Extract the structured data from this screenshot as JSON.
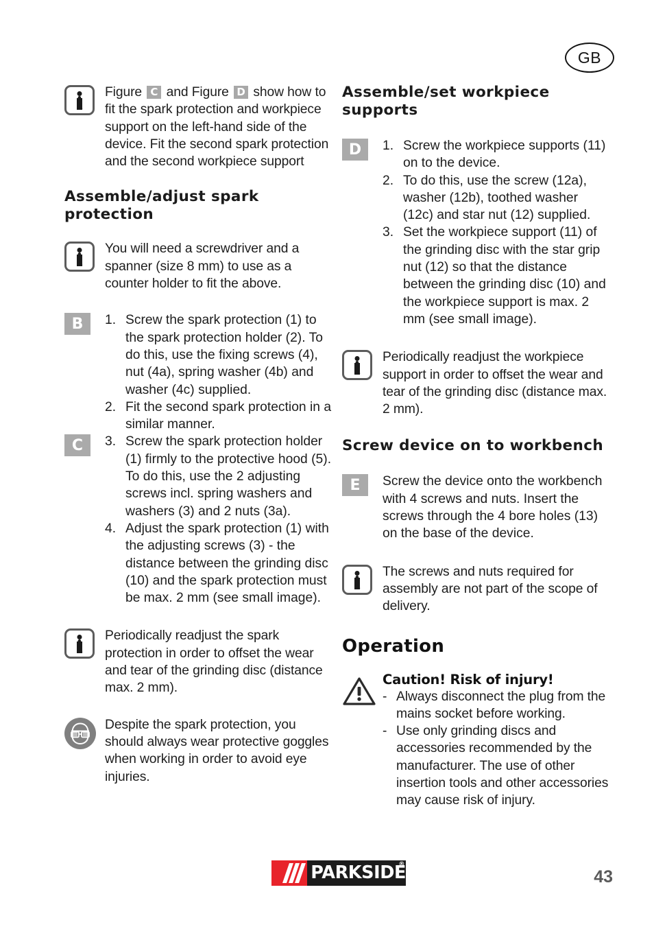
{
  "page": {
    "country_code": "GB",
    "number": "43",
    "brand": "PARKSIDE",
    "brand_registered": "®"
  },
  "left_column": {
    "note_figures": {
      "icon": "info-icon",
      "text_before": "Figure",
      "badge_c": "C",
      "text_middle": "and Figure",
      "badge_d": "D",
      "text_after": "show how to fit the spark protection and workpiece support on the left-hand side of the device. Fit the second spark protection and the second workpiece support"
    },
    "heading_spark": "Assemble/adjust spark protection",
    "note_tools": {
      "icon": "info-icon",
      "text": "You will need a screwdriver and a spanner (size 8 mm) to use as a counter holder to fit the above."
    },
    "steps_b": {
      "badge": "B",
      "items": [
        {
          "num": "1.",
          "text": "Screw the spark protection (1) to the spark protection holder (2). To do this, use the fixing screws (4), nut (4a), spring washer (4b) and washer (4c) supplied."
        },
        {
          "num": "2.",
          "text": "Fit the second spark protection in a similar manner."
        }
      ]
    },
    "steps_c": {
      "badge": "C",
      "items": [
        {
          "num": "3.",
          "text": "Screw the spark protection holder (1) firmly to the protective hood (5). To do this, use the 2 adjusting screws incl. spring washers and washers (3) and 2 nuts (3a)."
        },
        {
          "num": "4.",
          "text": "Adjust the spark protection (1) with the adjusting screws (3) - the distance between the grinding disc (10) and the spark protection must be max. 2 mm (see small image)."
        }
      ]
    },
    "note_readjust": {
      "icon": "info-icon",
      "text": "Periodically readjust the spark protection in order to offset the wear and tear of the grinding disc (distance max. 2 mm)."
    },
    "note_goggles": {
      "icon": "safety-goggles-icon",
      "text": "Despite the spark protection, you should always wear protective goggles when working in order to avoid eye injuries."
    }
  },
  "right_column": {
    "heading_workpiece": "Assemble/set workpiece supports",
    "steps_d": {
      "badge": "D",
      "items": [
        {
          "num": "1.",
          "text": "Screw the workpiece supports (11) on to the device."
        },
        {
          "num": "2.",
          "text": "To do this, use the screw (12a), washer (12b), toothed washer (12c) and star nut (12) supplied."
        },
        {
          "num": "3.",
          "text": "Set the workpiece support (11) of the grinding disc with the star grip nut (12) so that the distance between the grinding disc (10) and the workpiece support is max. 2 mm (see small image)."
        }
      ]
    },
    "note_readjust_workpiece": {
      "icon": "info-icon",
      "text": "Periodically readjust the workpiece support in order to offset the wear and tear of the grinding disc (distance max. 2 mm)."
    },
    "heading_workbench": "Screw device on to workbench",
    "step_e": {
      "badge": "E",
      "text": "Screw the device onto the workbench with 4 screws and nuts. Insert the screws through the 4 bore holes (13) on the base of the device."
    },
    "note_screws": {
      "icon": "info-icon",
      "text": "The screws and nuts required for assembly are not part of the scope of delivery."
    },
    "heading_operation": "Operation",
    "caution": {
      "icon": "warning-triangle-icon",
      "title": "Caution! Risk of injury!",
      "items": [
        {
          "dash": "-",
          "text": "Always disconnect the plug from the mains socket before working."
        },
        {
          "dash": "-",
          "text": "Use only grinding discs and accessories recommended by the manufacturer. The use of other insertion tools and other accessories may cause risk of injury."
        }
      ]
    }
  }
}
